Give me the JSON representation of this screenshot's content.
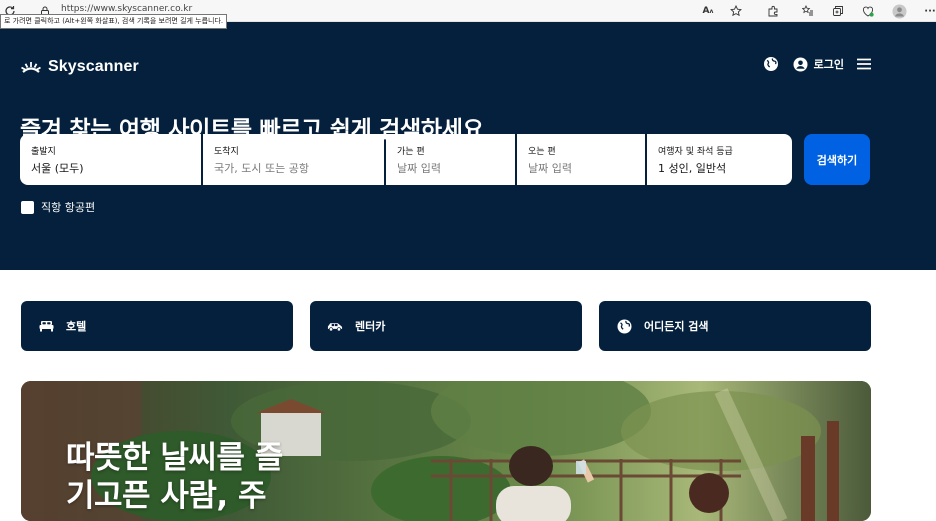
{
  "browser": {
    "url": "https://www.skyscanner.co.kr",
    "tooltip": "로 가려면 클릭하고 (Alt+왼쪽 화살표), 검색 기록을 보려면 길게 누릅니다.",
    "more_label": "···"
  },
  "header": {
    "brand": "Skyscanner",
    "login_label": "로그인"
  },
  "hero": {
    "headline": "즐겨 찾는 여행 사이트를 빠르고 쉽게 검색하세요"
  },
  "search": {
    "origin": {
      "label": "출발지",
      "value": "서울 (모두)"
    },
    "destination": {
      "label": "도착지",
      "placeholder": "국가, 도시 또는 공항"
    },
    "depart": {
      "label": "가는 편",
      "placeholder": "날짜 입력"
    },
    "return": {
      "label": "오는 편",
      "placeholder": "날짜 입력"
    },
    "travellers": {
      "label": "여행자 및 좌석 등급",
      "value": "1 성인, 일반석"
    },
    "search_button": "검색하기",
    "direct_label": "직항 항공편"
  },
  "shortcuts": [
    {
      "label": "호텔",
      "icon": "bed-icon"
    },
    {
      "label": "렌터카",
      "icon": "car-icon"
    },
    {
      "label": "어디든지 검색",
      "icon": "globe-icon"
    }
  ],
  "promo": {
    "title": "따뜻한 날씨를 즐\n기고픈 사람, 주"
  },
  "colors": {
    "navy": "#05203c",
    "blue": "#0062e3"
  }
}
